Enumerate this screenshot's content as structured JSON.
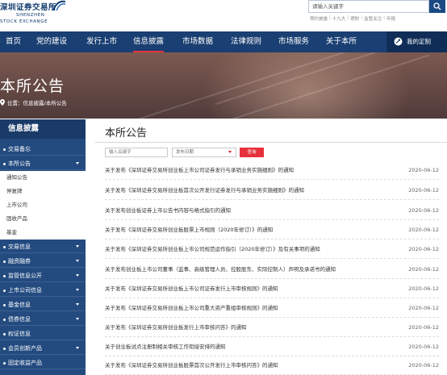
{
  "header": {
    "logo_zh": "深圳证券交易所",
    "logo_en_1": "SHENZHEN",
    "logo_en_2": "STOCK EXCHANGE",
    "search_placeholder": "请输入关键字",
    "hot_links": [
      "预约披露",
      "十九大",
      "理财",
      "监管关注",
      "年报"
    ]
  },
  "nav": {
    "items": [
      "首页",
      "党的建设",
      "发行上市",
      "信息披露",
      "市场数据",
      "法律规则",
      "市场服务",
      "关于本所"
    ],
    "active": "信息披露",
    "custom_label": "我的定制"
  },
  "banner": {
    "title": "本所公告",
    "breadcrumb_prefix": "位置：",
    "breadcrumb": "信息披露/本所公告"
  },
  "sidebar": {
    "heading": "信息披露",
    "items": [
      {
        "label": "交易备忘",
        "expandable": false
      },
      {
        "label": "本所公告",
        "expandable": true
      },
      {
        "label": "交易信息",
        "expandable": true
      },
      {
        "label": "融资融券",
        "expandable": true
      },
      {
        "label": "监管信息公开",
        "expandable": true
      },
      {
        "label": "上市公司信息",
        "expandable": true
      },
      {
        "label": "基金信息",
        "expandable": true
      },
      {
        "label": "债券信息",
        "expandable": true
      },
      {
        "label": "权证信息",
        "expandable": false
      },
      {
        "label": "会员创新产品",
        "expandable": true
      },
      {
        "label": "固定收益产品",
        "expandable": false
      }
    ],
    "subitems": [
      "通知公告",
      "停复牌",
      "上市公司",
      "固收产品",
      "基金"
    ]
  },
  "main": {
    "title": "本所公告",
    "keyword_placeholder": "输入关键字",
    "date_placeholder": "发布日期",
    "query_label": "查询",
    "rows": [
      {
        "title": "关于发布《深圳证券交易所创业板上市公司证券发行与承销业务实施细则》的通知",
        "date": "2020-06-12"
      },
      {
        "title": "关于发布《深圳证券交易所创业板首次公开发行证券发行与承销业务实施细则》的通知",
        "date": "2020-06-12"
      },
      {
        "title": "关于发布创业板证券上市公告书内容与格式指引的通知",
        "date": "2020-06-12"
      },
      {
        "title": "关于发布《深圳证券交易所创业板股票上市规则（2020年修订）》的通知",
        "date": "2020-06-12"
      },
      {
        "title": "关于发布《深圳证券交易所创业板上市公司规范运作指引（2020年修订）》及有关事项的通知",
        "date": "2020-06-12"
      },
      {
        "title": "关于发布创业板上市公司董事（监事、高级管理人员、控股股东、实际控制人）声明及承诺书的通知",
        "date": "2020-06-12"
      },
      {
        "title": "关于发布《深圳证券交易所创业板上市公司证券发行上市审核规则》的通知",
        "date": "2020-06-12"
      },
      {
        "title": "关于发布《深圳证券交易所创业板上市公司重大资产重组审核规则》的通知",
        "date": "2020-06-12"
      },
      {
        "title": "关于发布《深圳证券交易所创业板发行上市审核问答》的通知",
        "date": "2020-06-12"
      },
      {
        "title": "关于创业板试点注册制相关审核工作衔接安排的通知",
        "date": "2020-06-12"
      },
      {
        "title": "关于发布《深圳证券交易所创业板股票首次公开发行上市审核问答》的通知",
        "date": "2020-06-12"
      }
    ]
  },
  "colors": {
    "nav_bg": "#1a3f72",
    "sidebar_bg": "#234b80",
    "accent_red": "#e6323c"
  }
}
